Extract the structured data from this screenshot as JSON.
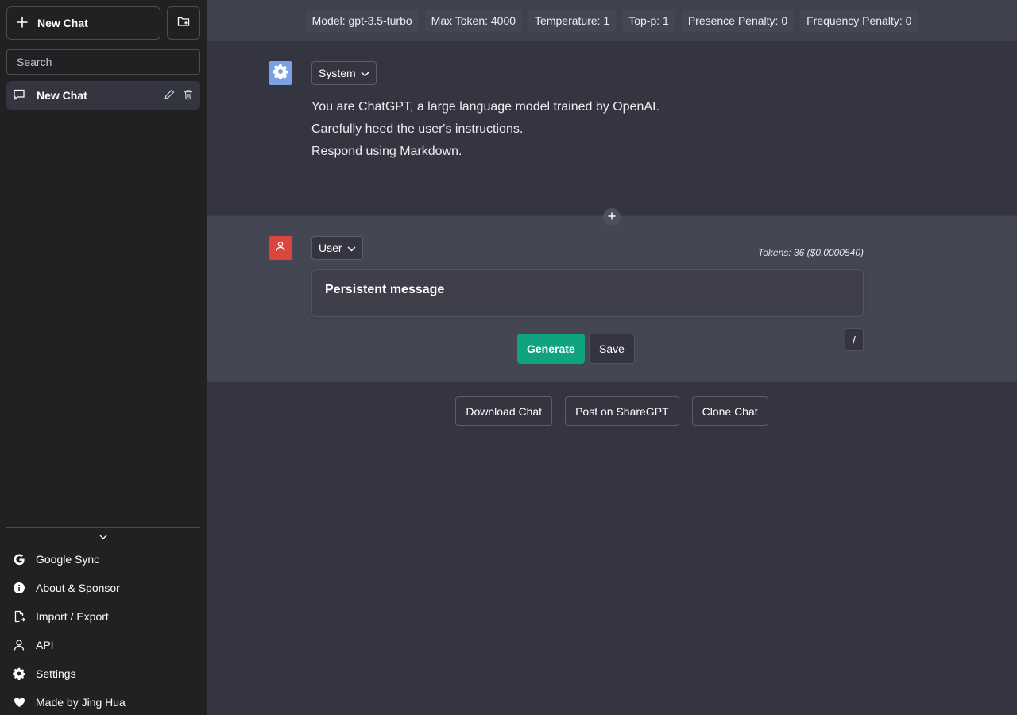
{
  "sidebar": {
    "new_chat_label": "New Chat",
    "search_placeholder": "Search",
    "chats": [
      {
        "title": "New Chat"
      }
    ],
    "menu": [
      {
        "label": "Google Sync",
        "icon": "google-icon"
      },
      {
        "label": "About & Sponsor",
        "icon": "info-icon"
      },
      {
        "label": "Import / Export",
        "icon": "file-export-icon"
      },
      {
        "label": "API",
        "icon": "person-icon"
      },
      {
        "label": "Settings",
        "icon": "gear-icon"
      },
      {
        "label": "Made by Jing Hua",
        "icon": "heart-icon"
      }
    ]
  },
  "config": {
    "model": "Model: gpt-3.5-turbo",
    "max_token": "Max Token: 4000",
    "temperature": "Temperature: 1",
    "top_p": "Top-p: 1",
    "presence_penalty": "Presence Penalty: 0",
    "frequency_penalty": "Frequency Penalty: 0"
  },
  "system_message": {
    "role": "System",
    "lines": [
      "You are ChatGPT, a large language model trained by OpenAI.",
      "Carefully heed the user's instructions.",
      "Respond using Markdown."
    ]
  },
  "user_message": {
    "role": "User",
    "tokens": "Tokens: 36 ($0.0000540)",
    "text": "Persistent message",
    "generate_label": "Generate",
    "save_label": "Save",
    "slash_label": "/"
  },
  "actions": {
    "download": "Download Chat",
    "share": "Post on ShareGPT",
    "clone": "Clone Chat"
  },
  "colors": {
    "system_avatar": "#7aa2e3",
    "user_avatar": "#d9453f",
    "generate": "#10a37f"
  }
}
